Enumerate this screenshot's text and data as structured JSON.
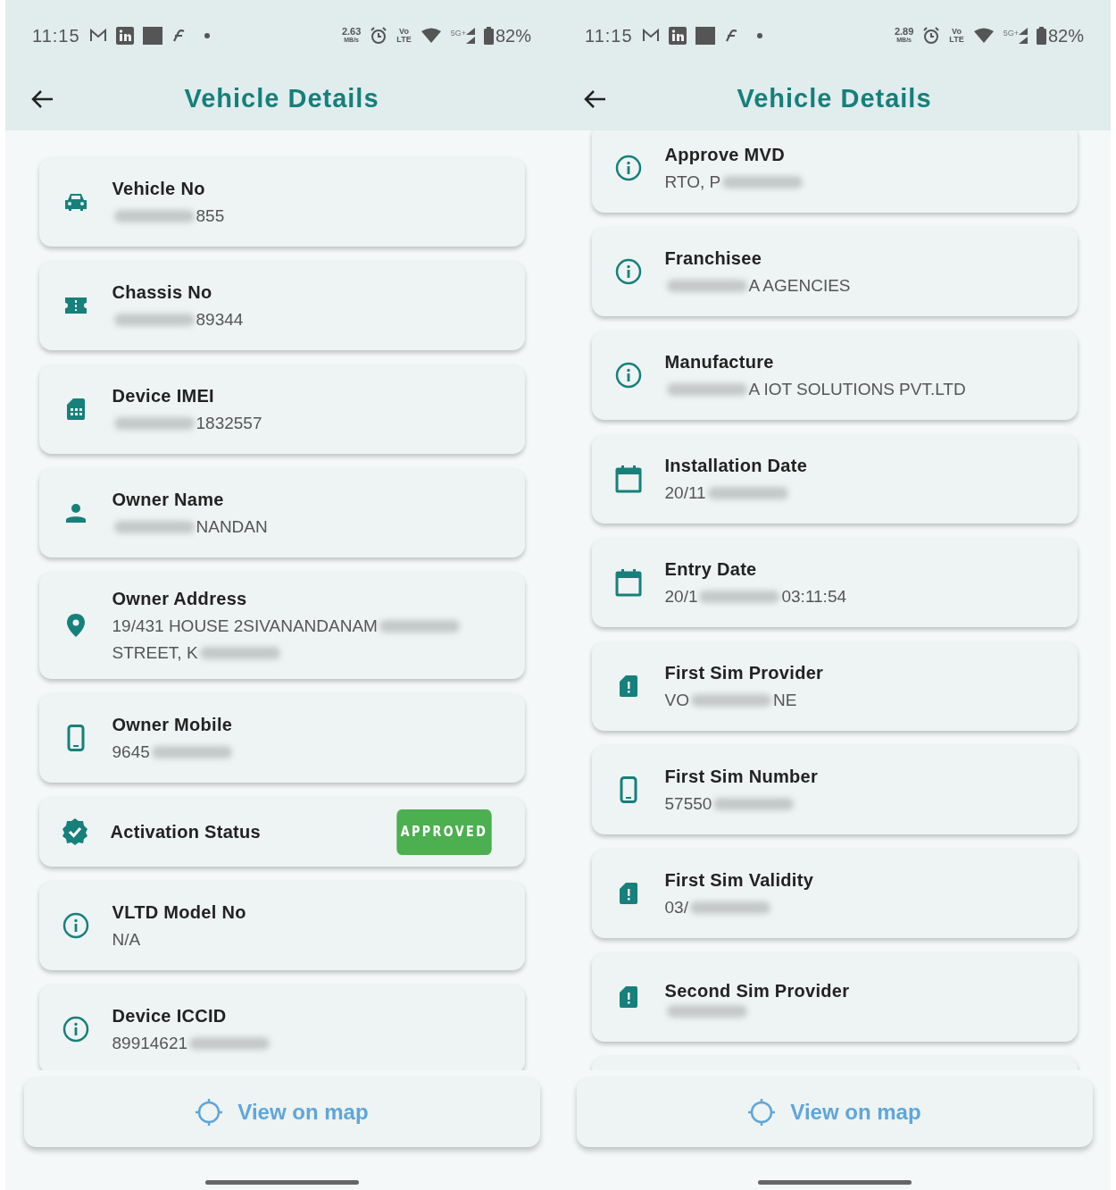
{
  "screens": [
    {
      "status_bar": {
        "time": "11:15",
        "speed": "2.63",
        "speed_unit": "MB/s",
        "volte_top": "Vo",
        "volte_bottom": "LTE",
        "network": "5G+",
        "battery": "82%"
      },
      "header": {
        "title": "Vehicle Details"
      },
      "cards": [
        {
          "kind": "car",
          "title": "Vehicle No",
          "value": [
            {
              "kind": "blur"
            },
            {
              "kind": "text",
              "text": "855"
            }
          ]
        },
        {
          "kind": "ticket",
          "title": "Chassis No",
          "value": [
            {
              "kind": "blur"
            },
            {
              "kind": "text",
              "text": "89344"
            }
          ]
        },
        {
          "kind": "sim",
          "title": "Device IMEI",
          "value": [
            {
              "kind": "blur"
            },
            {
              "kind": "text",
              "text": "1832557"
            }
          ]
        },
        {
          "kind": "person",
          "title": "Owner Name",
          "value": [
            {
              "kind": "blur"
            },
            {
              "kind": "text",
              "text": "NANDAN"
            }
          ]
        },
        {
          "kind": "pin",
          "title": "Owner Address",
          "value": [
            {
              "kind": "text",
              "text": "19/431 HOUSE 2SIVANANDANAM"
            },
            {
              "kind": "blur"
            },
            {
              "kind": "break"
            },
            {
              "kind": "text",
              "text": "STREET, K"
            },
            {
              "kind": "blur"
            }
          ]
        },
        {
          "kind": "phone",
          "title": "Owner Mobile",
          "value": [
            {
              "kind": "text",
              "text": "9645"
            },
            {
              "kind": "blur"
            }
          ]
        },
        {
          "kind": "status",
          "title": "Activation Status",
          "badge": "APPROVED"
        },
        {
          "kind": "info",
          "title": "VLTD Model No",
          "value": [
            {
              "kind": "text",
              "text": "N/A"
            }
          ]
        },
        {
          "kind": "info",
          "title": "Device ICCID",
          "value": [
            {
              "kind": "text",
              "text": "89914621"
            },
            {
              "kind": "blur"
            }
          ]
        }
      ],
      "map_button": {
        "label": "View on map"
      }
    },
    {
      "status_bar": {
        "time": "11:15",
        "speed": "2.89",
        "speed_unit": "MB/s",
        "volte_top": "Vo",
        "volte_bottom": "LTE",
        "network": "5G+",
        "battery": "82%"
      },
      "header": {
        "title": "Vehicle Details"
      },
      "cards": [
        {
          "kind": "info",
          "title": "Approve MVD",
          "value": [
            {
              "kind": "text",
              "text": "RTO, P"
            },
            {
              "kind": "blur"
            }
          ]
        },
        {
          "kind": "info",
          "title": "Franchisee",
          "value": [
            {
              "kind": "blur"
            },
            {
              "kind": "text",
              "text": "A AGENCIES"
            }
          ]
        },
        {
          "kind": "info",
          "title": "Manufacture",
          "value": [
            {
              "kind": "blur"
            },
            {
              "kind": "text",
              "text": "A IOT SOLUTIONS PVT.LTD"
            }
          ]
        },
        {
          "kind": "calendar",
          "title": "Installation Date",
          "value": [
            {
              "kind": "text",
              "text": "20/11"
            },
            {
              "kind": "blur"
            }
          ]
        },
        {
          "kind": "calendar",
          "title": "Entry Date",
          "value": [
            {
              "kind": "text",
              "text": "20/1"
            },
            {
              "kind": "blur"
            },
            {
              "kind": "text",
              "text": "03:11:54"
            }
          ]
        },
        {
          "kind": "simalert",
          "title": "First Sim Provider",
          "value": [
            {
              "kind": "text",
              "text": "VO"
            },
            {
              "kind": "blur"
            },
            {
              "kind": "text",
              "text": "NE"
            }
          ]
        },
        {
          "kind": "phone",
          "title": "First Sim Number",
          "value": [
            {
              "kind": "text",
              "text": "57550"
            },
            {
              "kind": "blur"
            }
          ]
        },
        {
          "kind": "simalert",
          "title": "First Sim Validity",
          "value": [
            {
              "kind": "text",
              "text": "03/"
            },
            {
              "kind": "blur"
            }
          ]
        },
        {
          "kind": "simalert",
          "title": "Second Sim Provider",
          "value": [
            {
              "kind": "blur"
            }
          ]
        },
        {
          "kind": "blank"
        }
      ],
      "map_button": {
        "label": "View on map"
      }
    }
  ]
}
